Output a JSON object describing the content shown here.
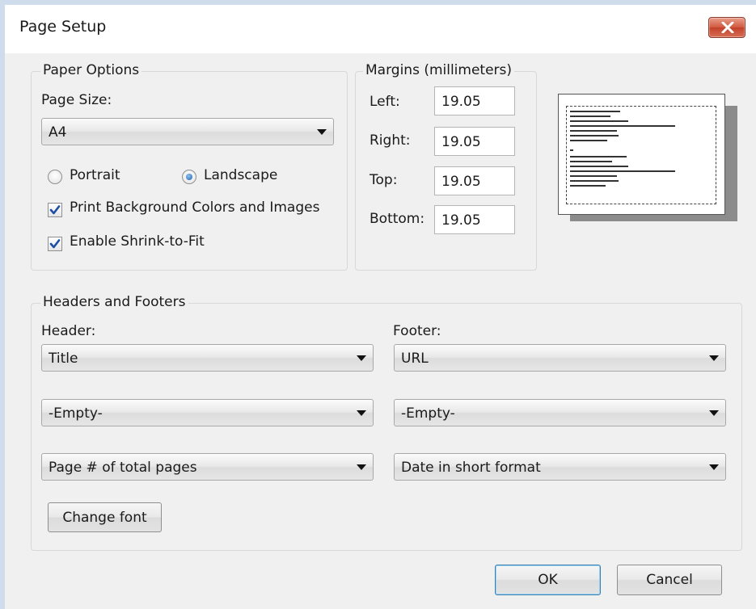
{
  "window": {
    "title": "Page Setup"
  },
  "paper_options": {
    "legend": "Paper Options",
    "page_size_label": "Page Size:",
    "page_size_value": "A4",
    "orientation": {
      "portrait_label": "Portrait",
      "landscape_label": "Landscape",
      "selected": "Landscape"
    },
    "print_background": {
      "label": "Print Background Colors and Images",
      "checked": true
    },
    "shrink_to_fit": {
      "label": "Enable Shrink-to-Fit",
      "checked": true
    }
  },
  "margins": {
    "legend": "Margins (millimeters)",
    "left_label": "Left:",
    "left_value": "19.05",
    "right_label": "Right:",
    "right_value": "19.05",
    "top_label": "Top:",
    "top_value": "19.05",
    "bottom_label": "Bottom:",
    "bottom_value": "19.05"
  },
  "headers_footers": {
    "legend": "Headers and Footers",
    "header_label": "Header:",
    "footer_label": "Footer:",
    "header_values": [
      "Title",
      "-Empty-",
      "Page # of total pages"
    ],
    "footer_values": [
      "URL",
      "-Empty-",
      "Date in short format"
    ],
    "change_font_label": "Change font"
  },
  "buttons": {
    "ok_label": "OK",
    "cancel_label": "Cancel"
  },
  "colors": {
    "close_button": "#c8462d",
    "checkbox_check": "#1c4ea6",
    "radio_selected": "#1c5fae",
    "default_button_border": "#3c7fb1"
  }
}
